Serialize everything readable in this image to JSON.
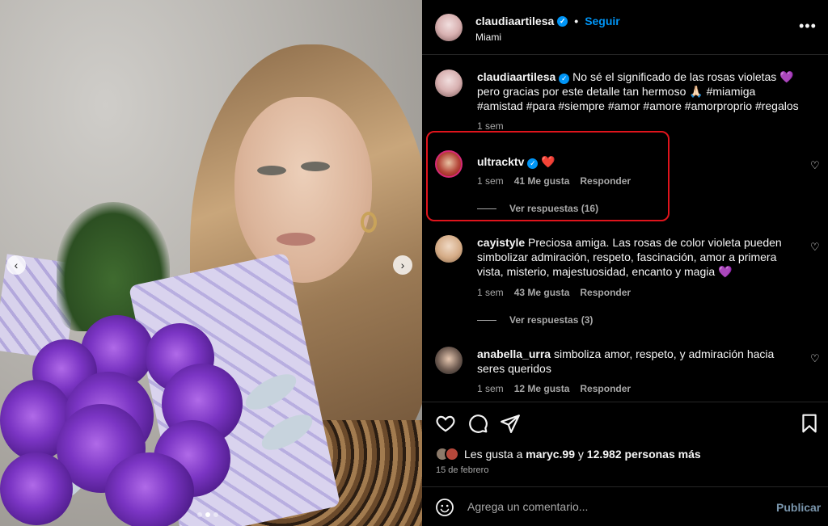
{
  "post": {
    "username": "claudiaartilesa",
    "follow_label": "Seguir",
    "separator": "•",
    "location": "Miami",
    "more_icon": "•••",
    "carousel_prev": "‹",
    "carousel_next": "›"
  },
  "comments": [
    {
      "username": "claudiaartilesa",
      "text": " No sé el significado de las rosas violetas 💜 pero gracias por este detalle tan hermoso 🙏🏻 #miamiga #amistad #para #siempre #amor #amore #amorproprio #regalos",
      "time": "1 sem"
    },
    {
      "username": "ultracktv",
      "text": " ❤️",
      "time": "1 sem",
      "likes": "41 Me gusta",
      "reply": "Responder",
      "view_replies": "Ver respuestas (16)"
    },
    {
      "username": "cayistyle",
      "text": " Preciosa amiga. Las rosas de color violeta pueden simbolizar admiración, respeto, fascinación, amor a primera vista, misterio, majestuosidad, encanto y magia 💜",
      "time": "1 sem",
      "likes": "43 Me gusta",
      "reply": "Responder",
      "view_replies": "Ver respuestas (3)"
    },
    {
      "username": "anabella_urra",
      "text": " simboliza amor, respeto, y admiración hacia seres queridos",
      "time": "1 sem",
      "likes": "12 Me gusta",
      "reply": "Responder"
    }
  ],
  "likes_summary": {
    "prefix": "Les gusta a ",
    "user": "maryc.99",
    "middle": " y ",
    "count": "12.982 personas más"
  },
  "date": "15 de febrero",
  "add_comment": {
    "placeholder": "Agrega un comentario...",
    "publish_label": "Publicar"
  },
  "icons": [
    "heart-icon",
    "comment-icon",
    "share-icon",
    "bookmark-icon",
    "emoji-icon",
    "verified-icon",
    "more-icon"
  ],
  "colors": {
    "background": "#000000",
    "text": "#f5f5f5",
    "secondary_text": "#a8a8a8",
    "link_blue": "#0095f6",
    "highlight_red": "#e0141c",
    "publish_disabled": "#7a96ad"
  }
}
